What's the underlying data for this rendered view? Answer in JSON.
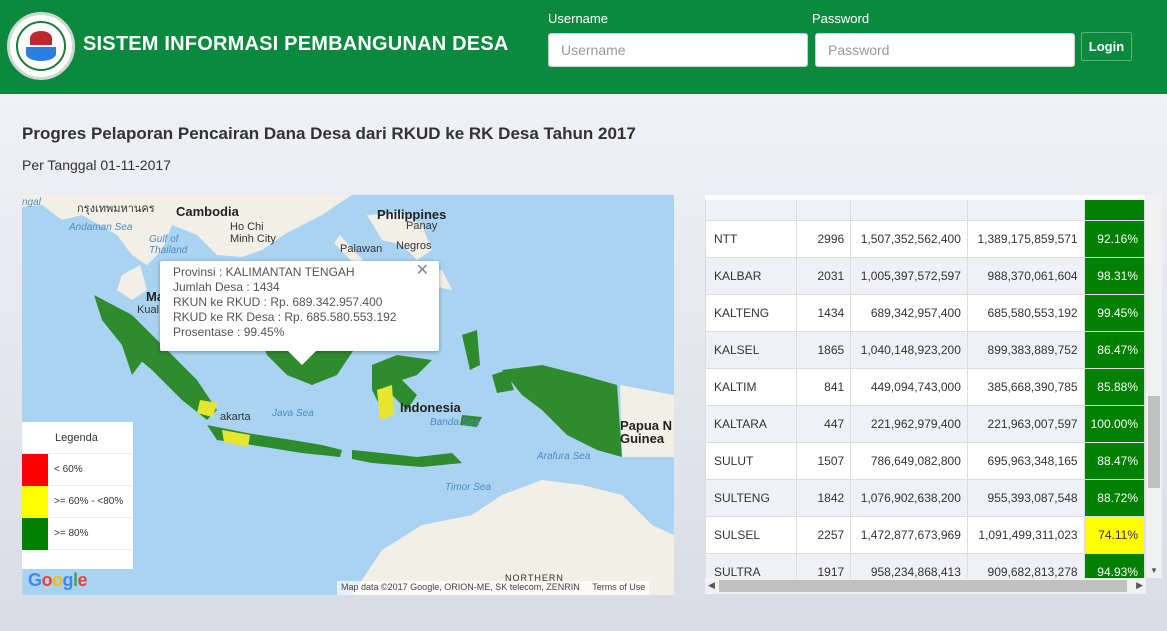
{
  "header": {
    "app_title": "SISTEM INFORMASI PEMBANGUNAN DESA",
    "username_label": "Username",
    "username_placeholder": "Username",
    "password_label": "Password",
    "password_placeholder": "Password",
    "login_label": "Login"
  },
  "page": {
    "title": "Progres Pelaporan Pencairan Dana Desa dari RKUD ke RK Desa Tahun 2017",
    "subtitle": "Per Tanggal 01-11-2017"
  },
  "map": {
    "labels": {
      "ngal": "ngal",
      "bangkok": "กรุงเทพมหานคร",
      "cambodia": "Cambodia",
      "philippines": "Philippines",
      "andaman": "Andaman Sea",
      "hochiminh": "Ho Chi\nMinh City",
      "panay": "Panay",
      "gulf": "Gulf of\nThailand",
      "palawan": "Palawan",
      "negros": "Negros",
      "kual": "Kual",
      "ma": "Ma",
      "jakarta": "akarta",
      "java_sea": "Java Sea",
      "indonesia": "Indonesia",
      "banda": "Banda Sea",
      "papua": "Papua N\nGuinea",
      "arafura": "Arafura Sea",
      "timor": "Timor Sea",
      "northern": "NORTHERN"
    },
    "info": {
      "provinsi": "Provinsi : KALIMANTAN TENGAH",
      "jumlah": "Jumlah Desa : 1434",
      "rkun": "RKUN ke RKUD : Rp. 689.342.957.400",
      "rkud": "RKUD ke RK Desa : Rp. 685.580.553.192",
      "prosentase": "Prosentase : 99.45%",
      "close": "✕"
    },
    "legend": {
      "title": "Legenda",
      "items": [
        {
          "label": "< 60%",
          "color": "#ff0000"
        },
        {
          "label": ">= 60% - <80%",
          "color": "#ffff00"
        },
        {
          "label": ">= 80%",
          "color": "#008000"
        }
      ]
    },
    "attribution": "Map data ©2017 Google, ORION-ME, SK telecom, ZENRIN",
    "terms": "Terms of Use",
    "google": "Google"
  },
  "table": {
    "rows": [
      {
        "prov": "",
        "desa": "",
        "rkun": "",
        "rkud": "",
        "pct": "",
        "status": "green"
      },
      {
        "prov": "NTT",
        "desa": "2996",
        "rkun": "1,507,352,562,400",
        "rkud": "1,389,175,859,571",
        "pct": "92.16%",
        "status": "green"
      },
      {
        "prov": "KALBAR",
        "desa": "2031",
        "rkun": "1,005,397,572,597",
        "rkud": "988,370,061,604",
        "pct": "98.31%",
        "status": "green"
      },
      {
        "prov": "KALTENG",
        "desa": "1434",
        "rkun": "689,342,957,400",
        "rkud": "685,580,553,192",
        "pct": "99.45%",
        "status": "green"
      },
      {
        "prov": "KALSEL",
        "desa": "1865",
        "rkun": "1,040,148,923,200",
        "rkud": "899,383,889,752",
        "pct": "86.47%",
        "status": "green"
      },
      {
        "prov": "KALTIM",
        "desa": "841",
        "rkun": "449,094,743,000",
        "rkud": "385,668,390,785",
        "pct": "85.88%",
        "status": "green"
      },
      {
        "prov": "KALTARA",
        "desa": "447",
        "rkun": "221,962,979,400",
        "rkud": "221,963,007,597",
        "pct": "100.00%",
        "status": "green"
      },
      {
        "prov": "SULUT",
        "desa": "1507",
        "rkun": "786,649,082,800",
        "rkud": "695,963,348,165",
        "pct": "88.47%",
        "status": "green"
      },
      {
        "prov": "SULTENG",
        "desa": "1842",
        "rkun": "1,076,902,638,200",
        "rkud": "955,393,087,548",
        "pct": "88.72%",
        "status": "green"
      },
      {
        "prov": "SULSEL",
        "desa": "2257",
        "rkun": "1,472,877,673,969",
        "rkud": "1,091,499,311,023",
        "pct": "74.11%",
        "status": "yellow"
      },
      {
        "prov": "SULTRA",
        "desa": "1917",
        "rkun": "958,234,868,413",
        "rkud": "909,682,813,278",
        "pct": "94.93%",
        "status": "green"
      },
      {
        "prov": "",
        "desa": "",
        "rkun": "",
        "rkud": "",
        "pct": "",
        "status": "green"
      }
    ]
  }
}
